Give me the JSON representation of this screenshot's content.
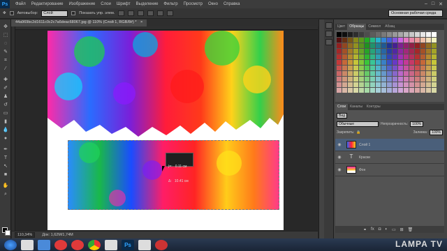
{
  "app": {
    "logo": "Ps"
  },
  "menu": [
    "Файл",
    "Редактирование",
    "Изображение",
    "Слои",
    "Шрифт",
    "Выделение",
    "Фильтр",
    "Просмотр",
    "Окно",
    "Справка"
  ],
  "window_controls": [
    "–",
    "□",
    "✕"
  ],
  "options": {
    "autoselect": "Автовыбор:",
    "autoselect_value": "Слой",
    "show_controls": "Показать упр. элем.",
    "workspace": "Основная рабочая среда"
  },
  "document": {
    "tab": "44a969bc2d1611c0c2c7a6deac68067.jpg @ 110% (Слой 1, RGB/8#) *",
    "close": "×"
  },
  "tooltip": {
    "l1": "|=:   0.11 см",
    "l2": "Δ:   10.41 см"
  },
  "status": {
    "zoom": "110,34%",
    "doc": "Док: 1,62M/1,74M"
  },
  "swatch_tabs": [
    "Цвет",
    "Образцы",
    "Символ",
    "Абзац"
  ],
  "layers_tabs": [
    "Слои",
    "Каналы",
    "Контуры"
  ],
  "layers": {
    "kind": "Вид",
    "mode": "Обычные",
    "opacity_label": "Непрозрачность:",
    "opacity": "100%",
    "lock_label": "Закрепить:",
    "fill_label": "Заливка:",
    "fill": "100%",
    "items": [
      {
        "name": "Слой 1"
      },
      {
        "name": "Краски"
      },
      {
        "name": "Фон"
      }
    ]
  },
  "taskbar": {
    "ps_icon": "Ps"
  },
  "watermark": "LAMPA TV"
}
